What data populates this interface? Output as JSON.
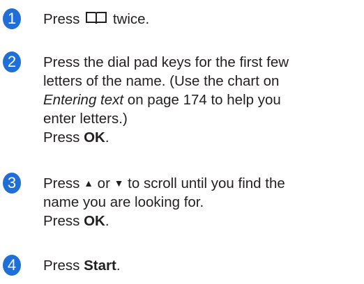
{
  "steps": [
    {
      "number": "1",
      "press": "Press",
      "icon": "address-book-icon",
      "twice": "twice."
    },
    {
      "number": "2",
      "line1": "Press the dial pad keys for the first few",
      "line2": "letters of the name. (Use the chart on",
      "link": "Entering text",
      "line3_rest": " on page 174 to help you",
      "line4": "enter letters.)",
      "press": "Press ",
      "ok": "OK",
      "period": "."
    },
    {
      "number": "3",
      "press": "Press ",
      "up_arrow": "▲",
      "or": " or ",
      "down_arrow": "▼",
      "line1_rest": " to scroll until you find the",
      "line2": "name you are looking for.",
      "press2": "Press ",
      "ok": "OK",
      "period": "."
    },
    {
      "number": "4",
      "press": "Press ",
      "start": "Start",
      "period": "."
    }
  ],
  "colors": {
    "badge": "#1f6fd6",
    "text": "#231f20"
  }
}
